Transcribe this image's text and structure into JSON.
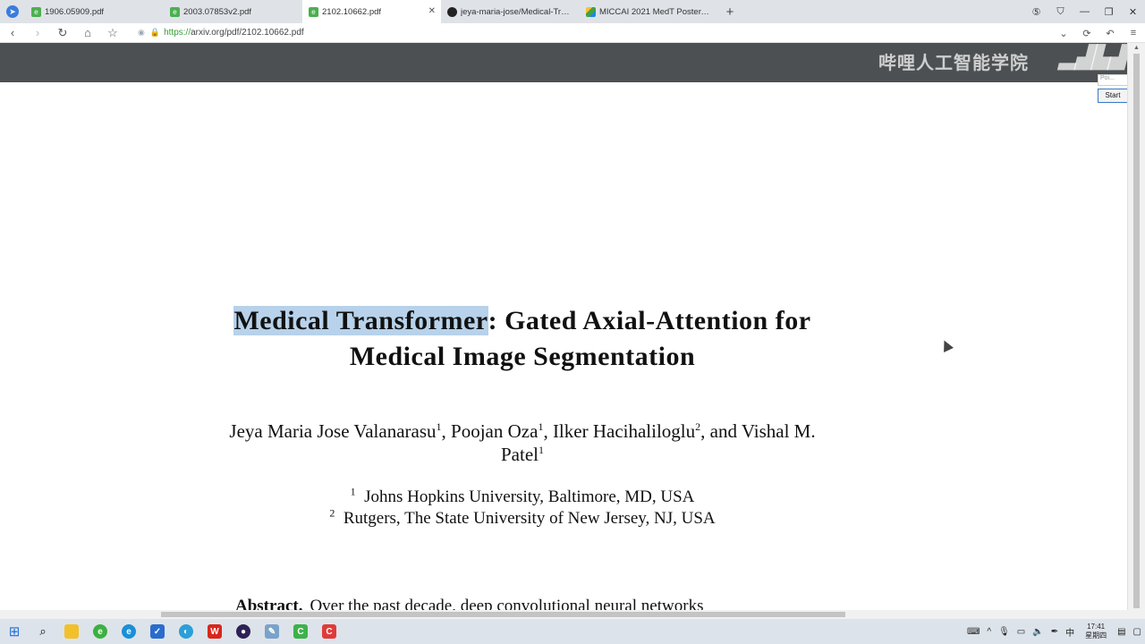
{
  "browser": {
    "tabs": [
      {
        "label": "1906.05909.pdf",
        "favicon": "pdf-icon",
        "active": false
      },
      {
        "label": "2003.07853v2.pdf",
        "favicon": "pdf-icon",
        "active": false
      },
      {
        "label": "2102.10662.pdf",
        "favicon": "pdf-icon",
        "active": true
      },
      {
        "label": "jeya-maria-jose/Medical-Tra…",
        "favicon": "github-icon",
        "active": false
      },
      {
        "label": "MICCAI 2021 MedT Poster.p…",
        "favicon": "drive-icon",
        "active": false
      }
    ],
    "new_tab": "+",
    "url_scheme": "https://",
    "url_rest": "arxiv.org/pdf/2102.10662.pdf"
  },
  "watermark": {
    "text": "哔哩人工智能学院",
    "logo": "bilibili"
  },
  "overlay": {
    "panel_text": "Poi...",
    "start_label": "Start"
  },
  "paper": {
    "title_highlight": "Medical Transformer",
    "title_rest_line1": ": Gated Axial-Attention for",
    "title_line2": "Medical Image Segmentation",
    "authors": [
      {
        "name": "Jeya Maria Jose Valanarasu",
        "sup": "1",
        "sep": ", "
      },
      {
        "name": "Poojan Oza",
        "sup": "1",
        "sep": ", "
      },
      {
        "name": "Ilker Hacihaliloglu",
        "sup": "2",
        "sep": ", and Vishal M."
      }
    ],
    "last_author_line2": "Patel",
    "last_author_sup": "1",
    "affiliations": [
      {
        "sup": "1",
        "text": "Johns Hopkins University, Baltimore, MD, USA"
      },
      {
        "sup": "2",
        "text": "Rutgers, The State University of New Jersey, NJ, USA"
      }
    ],
    "abstract_label": "Abstract.",
    "abstract_start": "Over the past decade, deep convolutional neural networks"
  },
  "taskbar": {
    "time": "17:41",
    "day": "星期四",
    "ime": "中"
  },
  "colors": {
    "highlight": "#b7d2ea",
    "pdf_toolbar": "#4d5052"
  }
}
